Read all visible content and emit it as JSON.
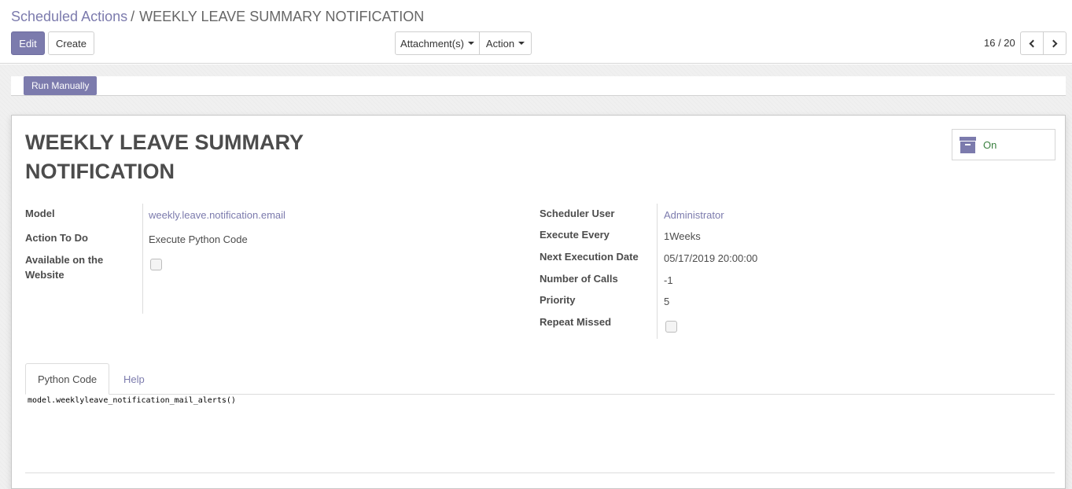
{
  "breadcrumb": {
    "parent": "Scheduled Actions",
    "separator": "/",
    "current": "WEEKLY LEAVE SUMMARY NOTIFICATION"
  },
  "toolbar": {
    "edit_label": "Edit",
    "create_label": "Create",
    "attachments_label": "Attachment(s)",
    "action_label": "Action"
  },
  "pager": {
    "value": "16 / 20"
  },
  "statusbar": {
    "run_manually_label": "Run Manually"
  },
  "record": {
    "title": "WEEKLY LEAVE SUMMARY NOTIFICATION",
    "active_label": "On",
    "left_fields": {
      "model_label": "Model",
      "model_value": "weekly.leave.notification.email",
      "action_label": "Action To Do",
      "action_value": "Execute Python Code",
      "website_label": "Available on the Website",
      "website_checked": false
    },
    "right_fields": {
      "user_label": "Scheduler User",
      "user_value": "Administrator",
      "interval_label": "Execute Every",
      "interval_value": "1Weeks",
      "nextcall_label": "Next Execution Date",
      "nextcall_value": "05/17/2019 20:00:00",
      "numcall_label": "Number of Calls",
      "numcall_value": "-1",
      "priority_label": "Priority",
      "priority_value": "5",
      "repeat_label": "Repeat Missed",
      "repeat_checked": false
    }
  },
  "tabs": {
    "python_code": "Python Code",
    "help": "Help"
  },
  "code": "model.weeklyleave_notification_mail_alerts()",
  "colors": {
    "accent": "#7c7bad",
    "active_green": "#3b8141"
  },
  "icons": [
    "caret-down-icon",
    "chevron-left-icon",
    "chevron-right-icon",
    "archive-icon"
  ]
}
